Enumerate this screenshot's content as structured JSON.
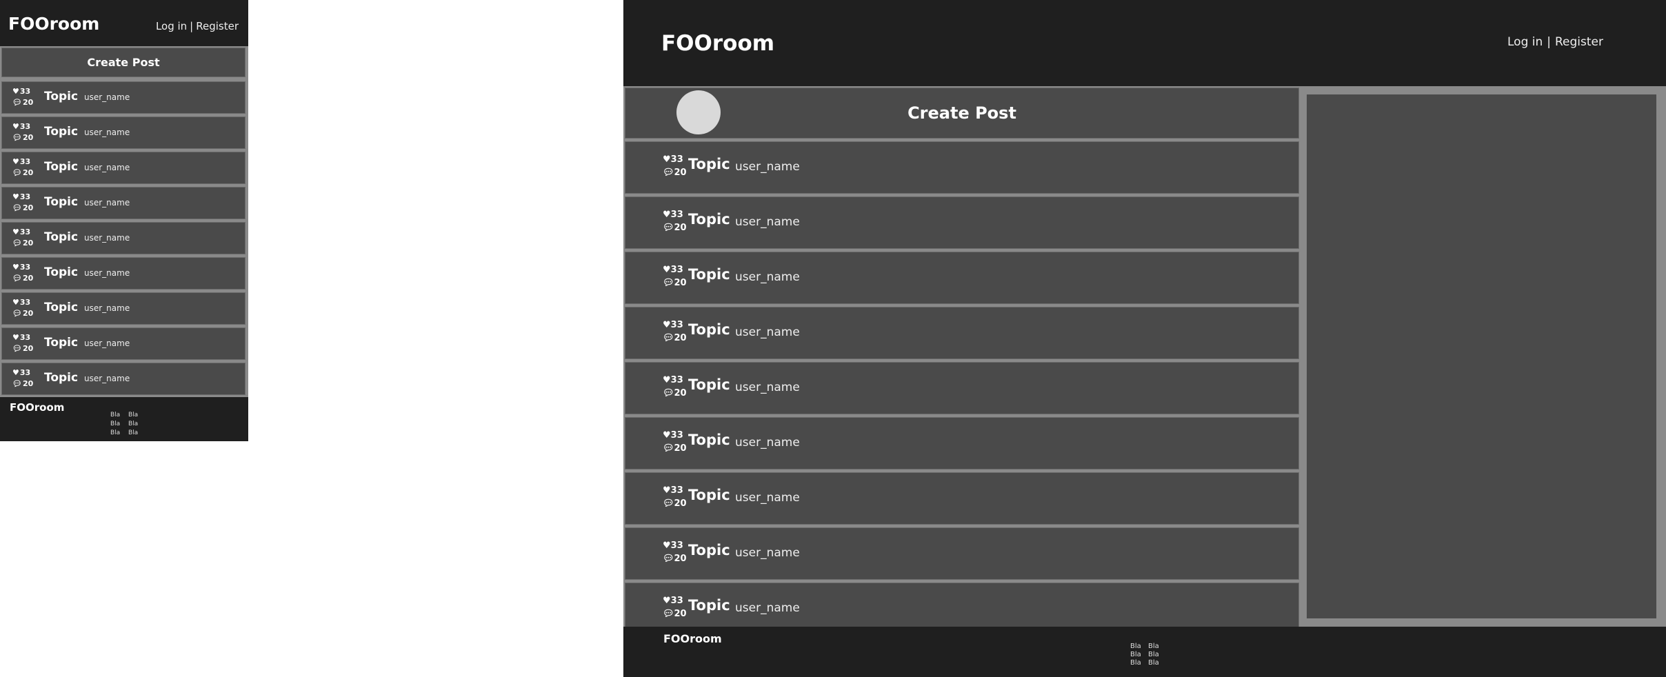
{
  "site": {
    "logo": "FOOroom",
    "login_label": "Log in",
    "separator": "|",
    "register_label": "Register",
    "create_post_label": "Create Post"
  },
  "posts": [
    {
      "likes": "33",
      "comments": "20",
      "topic": "Topic",
      "user": "user_name"
    },
    {
      "likes": "33",
      "comments": "20",
      "topic": "Topic",
      "user": "user_name"
    },
    {
      "likes": "33",
      "comments": "20",
      "topic": "Topic",
      "user": "user_name"
    },
    {
      "likes": "33",
      "comments": "20",
      "topic": "Topic",
      "user": "user_name"
    },
    {
      "likes": "33",
      "comments": "20",
      "topic": "Topic",
      "user": "user_name"
    },
    {
      "likes": "33",
      "comments": "20",
      "topic": "Topic",
      "user": "user_name"
    },
    {
      "likes": "33",
      "comments": "20",
      "topic": "Topic",
      "user": "user_name"
    },
    {
      "likes": "33",
      "comments": "20",
      "topic": "Topic",
      "user": "user_name"
    },
    {
      "likes": "33",
      "comments": "20",
      "topic": "Topic",
      "user": "user_name"
    }
  ],
  "footer": {
    "logo": "FOOroom",
    "links": [
      "Bla",
      "Bla",
      "Bla",
      "Bla",
      "Bla",
      "Bla"
    ]
  },
  "icons": {
    "like": "heart-icon",
    "comment": "comment-bubble-icon"
  },
  "colors": {
    "header_bg": "#1f1f1f",
    "page_bg": "#8a8a8a",
    "card_bg": "#4a4a4a",
    "avatar": "#d9d9d9"
  }
}
